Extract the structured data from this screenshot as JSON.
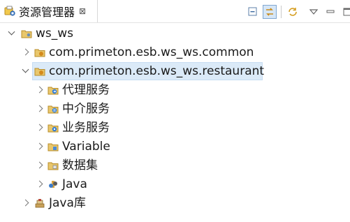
{
  "view": {
    "title": "资源管理器",
    "close_symbol": "⊠"
  },
  "toolbar": {
    "buttons": [
      {
        "icon": "collapse-all-icon"
      },
      {
        "icon": "link-with-editor-icon",
        "active": true
      },
      {
        "icon": "sync-icon"
      },
      {
        "icon": "view-menu-icon"
      },
      {
        "icon": "minimize-icon"
      },
      {
        "icon": "maximize-icon"
      }
    ]
  },
  "tree": {
    "project": "ws_ws",
    "common_package": "com.primeton.esb.ws_ws.common",
    "restaurant_package": "com.primeton.esb.ws_ws.restaurant",
    "children": [
      "代理服务",
      "中介服务",
      "业务服务",
      "Variable",
      "数据集",
      "Java"
    ],
    "library": "Java库"
  },
  "colors": {
    "selection": "#dbeaf8",
    "folder": "#e9c76c",
    "accent": "#2f7bd6"
  }
}
